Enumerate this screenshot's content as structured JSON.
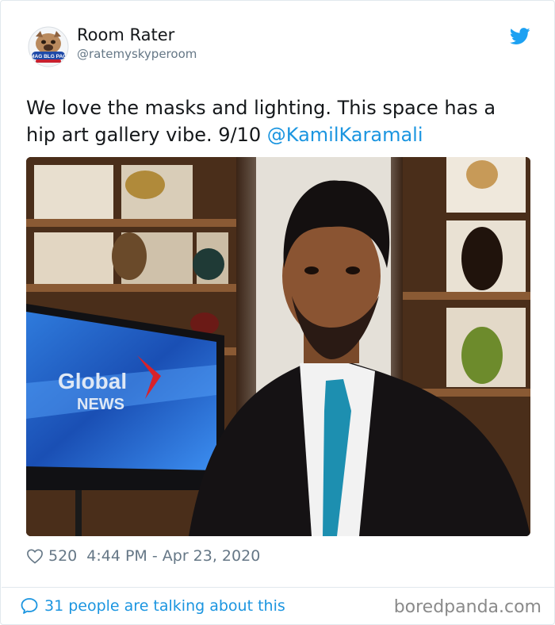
{
  "account": {
    "display_name": "Room Rater",
    "handle": "@ratemyskyperoom",
    "avatar_badge": "MAG BLG PAC"
  },
  "tweet": {
    "text": "We love the masks and lighting. This space has a hip art gallery vibe. 9/10 ",
    "mention": "@KamilKaramali"
  },
  "photo": {
    "tv_brand_line1": "Global",
    "tv_brand_line2": "NEWS"
  },
  "meta": {
    "like_count": "520",
    "timestamp": "4:44 PM - Apr 23, 2020"
  },
  "footer": {
    "talking_label": "31 people are talking about this",
    "watermark": "boredpanda.com"
  },
  "colors": {
    "link": "#1b95e0",
    "muted": "#657786",
    "border": "#e1e8ed"
  },
  "icons": {
    "brand": "twitter-bird-icon",
    "like": "heart-icon",
    "reply": "speech-bubble-icon"
  }
}
